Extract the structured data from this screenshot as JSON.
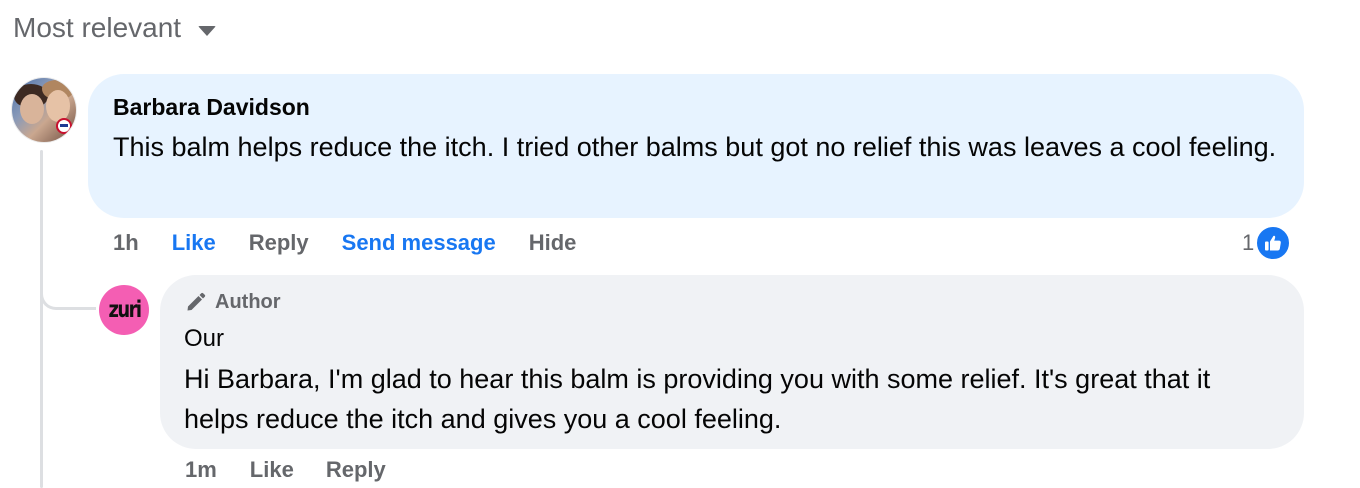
{
  "sort": {
    "label": "Most relevant",
    "icon": "caret-down-icon"
  },
  "comments": [
    {
      "author": "Barbara Davidson",
      "text": "This balm helps reduce the itch. I tried other balms but got no relief this was leaves a cool feeling.",
      "time": "1h",
      "actions": {
        "like": "Like",
        "reply": "Reply",
        "send_message": "Send message",
        "hide": "Hide"
      },
      "reaction_count": "1",
      "reaction_icon": "thumbs-up-icon",
      "bubble_color": "#e7f3ff",
      "reply": {
        "badge": "Author",
        "badge_icon": "pencil-icon",
        "author": "Our",
        "avatar_text": "zuri",
        "avatar_color": "#f45eb3",
        "text": "Hi Barbara, I'm glad to hear this balm is providing you with some relief. It's great that it helps reduce the itch and gives you a cool feeling.",
        "time": "1m",
        "actions": {
          "like": "Like",
          "reply": "Reply"
        },
        "bubble_color": "#f0f2f5"
      }
    }
  ],
  "colors": {
    "link_blue": "#1877f2",
    "secondary_text": "#65676b",
    "primary_text": "#050505",
    "thread_line": "#dddfe2"
  }
}
